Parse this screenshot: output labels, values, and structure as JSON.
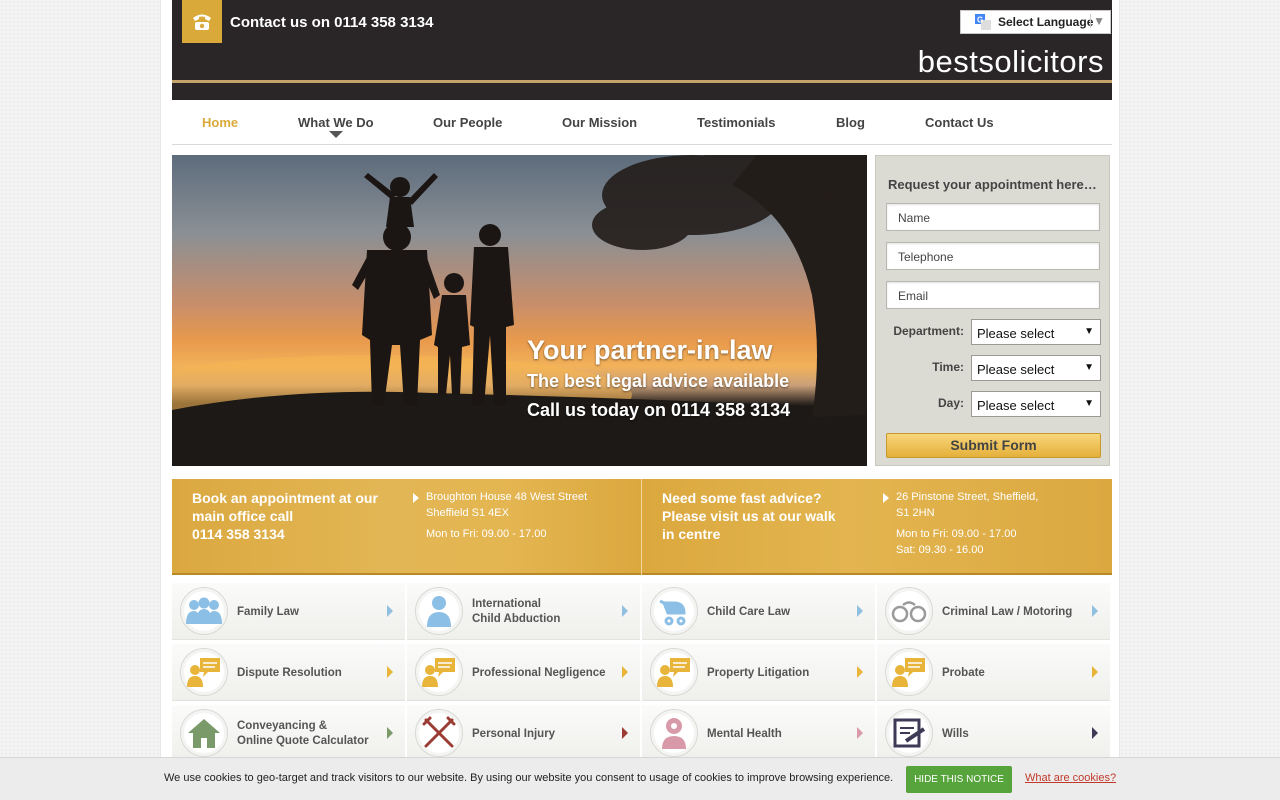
{
  "header": {
    "contact_text": "Contact us on 0114 358 3134",
    "language_label": "Select Language",
    "logo_prefix": "best",
    "logo_suffix": "solicitors"
  },
  "nav": {
    "items": [
      "Home",
      "What We Do",
      "Our People",
      "Our Mission",
      "Testimonials",
      "Blog",
      "Contact Us"
    ],
    "active": "Home"
  },
  "hero": {
    "line1": "Your partner-in-law",
    "line2": "The best legal advice available",
    "line3": "Call us today on 0114 358 3134"
  },
  "form": {
    "title": "Request your appointment here…",
    "name_placeholder": "Name",
    "telephone_placeholder": "Telephone",
    "email_placeholder": "Email",
    "department_label": "Department:",
    "department_value": "Please select",
    "time_label": "Time:",
    "time_value": "Please select",
    "day_label": "Day:",
    "day_value": "Please select",
    "submit_label": "Submit Form"
  },
  "band": {
    "left_heading_1": "Book an appointment at our",
    "left_heading_2": "main office call",
    "left_heading_3": "0114 358 3134",
    "left_address_1": "Broughton House 48 West Street",
    "left_address_2": "Sheffield S1 4EX",
    "left_hours": "Mon to Fri: 09.00 - 17.00",
    "right_heading_1": "Need some fast advice?",
    "right_heading_2": "Please visit us at our walk",
    "right_heading_3": "in centre",
    "right_address_1": "26 Pinstone Street, Sheffield,",
    "right_address_2": "S1 2HN",
    "right_hours_1": "Mon to Fri: 09.00 - 17.00",
    "right_hours_2": "Sat: 09.30 - 16.00"
  },
  "services": [
    {
      "line1": "Family Law",
      "line2": "",
      "icon": "family-icon"
    },
    {
      "line1": "International",
      "line2": "Child Abduction",
      "icon": "person-icon"
    },
    {
      "line1": "Child Care Law",
      "line2": "",
      "icon": "pram-icon"
    },
    {
      "line1": "Criminal Law / Motoring",
      "line2": "",
      "icon": "handcuffs-icon"
    },
    {
      "line1": "Dispute Resolution",
      "line2": "",
      "icon": "speech-person-icon"
    },
    {
      "line1": "Professional Negligence",
      "line2": "",
      "icon": "speech-person-icon"
    },
    {
      "line1": "Property Litigation",
      "line2": "",
      "icon": "speech-person-icon"
    },
    {
      "line1": "Probate",
      "line2": "",
      "icon": "speech-person-icon"
    },
    {
      "line1": "Conveyancing &",
      "line2": "Online Quote Calculator",
      "icon": "house-icon"
    },
    {
      "line1": "Personal Injury",
      "line2": "",
      "icon": "crutches-icon"
    },
    {
      "line1": "Mental Health",
      "line2": "",
      "icon": "head-icon"
    },
    {
      "line1": "Wills",
      "line2": "",
      "icon": "document-pen-icon"
    }
  ],
  "cookie": {
    "message": "We use cookies to geo-target and track visitors to our website. By using our website you consent to usage of cookies to improve browsing experience.",
    "button_label": "HIDE THIS NOTICE",
    "link_label": "What are cookies?"
  },
  "colors": {
    "header_bg": "#2a2526",
    "accent_gold": "#d9aa3a",
    "cookie_button": "#57a33c"
  }
}
